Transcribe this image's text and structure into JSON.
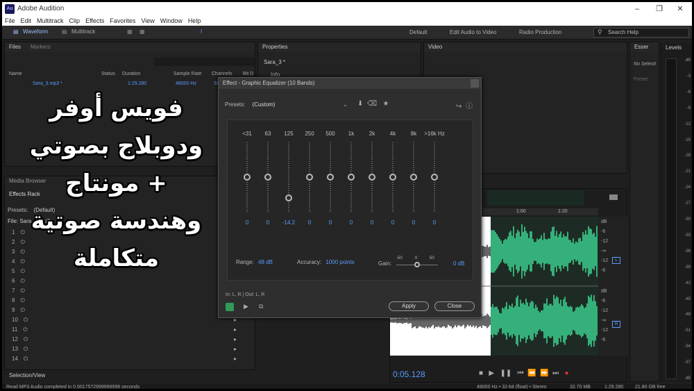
{
  "window": {
    "title": "Adobe Audition",
    "logo": "Au"
  },
  "menu": [
    "File",
    "Edit",
    "Multitrack",
    "Clip",
    "Effects",
    "Favorites",
    "View",
    "Window",
    "Help"
  ],
  "toolbar": {
    "waveform": "Waveform",
    "multitrack": "Multitrack",
    "workspaces": [
      "Default",
      "Edit Audio to Video",
      "Radio Production"
    ],
    "search_placeholder": "Search Help"
  },
  "files_panel": {
    "tabs": [
      "Files",
      "Markers"
    ],
    "columns": [
      "Name",
      "Status",
      "Duration",
      "Sample Rate",
      "Channels",
      "Bit D"
    ],
    "row": {
      "name": "Sara_3.mp3 *",
      "duration": "1:29.280",
      "sample_rate": "48000 Hz",
      "channels": "St"
    }
  },
  "media_browser": "Media Browser",
  "effects_rack": {
    "title": "Effects Rack",
    "presets_label": "Presets:",
    "presets_value": "(Default)",
    "file_label": "File: Sara_3.mp3",
    "slots": [
      "1",
      "2",
      "3",
      "4",
      "5",
      "6",
      "7",
      "8",
      "9",
      "10",
      "11",
      "12",
      "13",
      "14"
    ]
  },
  "selection_view": "Selection/View",
  "properties": {
    "title": "Properties",
    "file": "Sara_3 *",
    "info": "Info"
  },
  "video": {
    "title": "Video"
  },
  "essential": {
    "title": "Esser",
    "no_selection": "No Selecti",
    "preset": "Preset:"
  },
  "levels": {
    "title": "Levels",
    "ticks": [
      "dB",
      "-3",
      "-6",
      "-9",
      "-12",
      "-15",
      "-18",
      "-21",
      "-24",
      "-27",
      "-30",
      "-33",
      "-36",
      "-39",
      "-42",
      "-45",
      "-48",
      "-51",
      "-54",
      "-57",
      "dB"
    ]
  },
  "dialog": {
    "title": "Effect - Graphic Equalizer (10 Bands)",
    "presets_label": "Presets:",
    "presets_value": "(Custom)",
    "bands": [
      "<31",
      "63",
      "125",
      "250",
      "500",
      "1k",
      "2k",
      "4k",
      "8k",
      ">16k Hz"
    ],
    "band_values": [
      0,
      0,
      -14.2,
      0,
      0,
      0,
      0,
      0,
      0,
      0
    ],
    "range_label": "Range:",
    "range_value": "48 dB",
    "accuracy_label": "Accuracy:",
    "accuracy_value": "1000 points",
    "gain_label": "Gain:",
    "gain_ticks": [
      "-50",
      "0",
      "50"
    ],
    "gain_value": "0 dB",
    "io": "In: L, R | Out: L, R",
    "apply": "Apply",
    "close": "Close"
  },
  "editor": {
    "time_marks": [
      "1:00",
      "1:20"
    ],
    "db_ticks_top": [
      "dB",
      "-6",
      "-12",
      "-∞",
      "-12",
      "-6"
    ],
    "db_ticks_bottom": [
      "dB",
      "-6",
      "-12",
      "-∞",
      "-12",
      "-6"
    ],
    "channel_l": "L",
    "channel_r": "R",
    "current_time": "0:05.128",
    "wave_color": "#3ddc97"
  },
  "status": {
    "message": "Read MP3 Audio completed in 0.5017572999999996 seconds",
    "format": "48000 Hz • 32-bit (float) • Stereo",
    "size": "32.70 MB",
    "duration": "1:29.280",
    "free": "21.80 GB free"
  },
  "overlay_lines": [
    "فويس أوفر",
    "ودوبلاج بصوتي",
    "+ مونتاج",
    "وهندسة صوتية",
    "متكاملة"
  ]
}
